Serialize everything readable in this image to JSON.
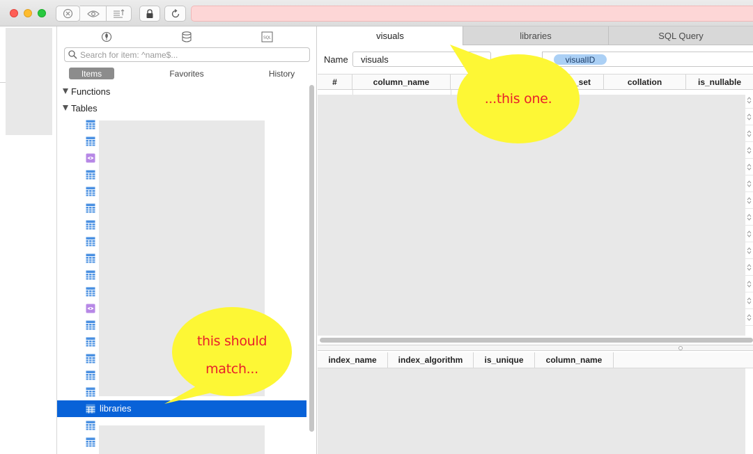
{
  "toolbar": {
    "url_placeholder": ""
  },
  "sidebar": {
    "search_placeholder": "Search for item: ^name$...",
    "segments": [
      "Items",
      "Favorites",
      "History"
    ],
    "tree": {
      "functions_label": "Functions",
      "tables_label": "Tables",
      "selected_table": "libraries"
    }
  },
  "main": {
    "tabs": [
      "visuals",
      "libraries",
      "SQL Query"
    ],
    "name_label": "Name",
    "name_value": "visuals",
    "key_token": "visualID",
    "columns": [
      "#",
      "column_name",
      "_set",
      "collation",
      "is_nullable"
    ],
    "index_columns": [
      "index_name",
      "index_algorithm",
      "is_unique",
      "column_name"
    ]
  },
  "callouts": {
    "left_line1": "this should",
    "left_line2": "match...",
    "right": "...this one."
  },
  "colors": {
    "selection": "#0862d8",
    "callout_fill": "#fdf735",
    "callout_text": "#e8202a"
  }
}
